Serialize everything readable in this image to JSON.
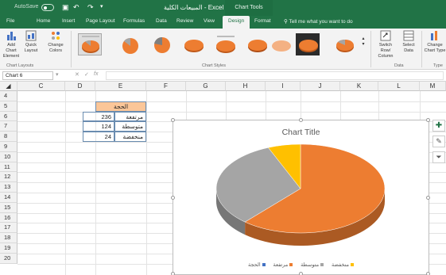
{
  "app": {
    "autosave_label": "AutoSave",
    "doc_title": "المبيعات الكلية - Excel",
    "context_tab": "Chart Tools"
  },
  "tabs": [
    "File",
    "Home",
    "Insert",
    "Page Layout",
    "Formulas",
    "Data",
    "Review",
    "View",
    "Design",
    "Format"
  ],
  "tell_me": "Tell me what you want to do",
  "ribbon": {
    "add_chart_element": "Add Chart Element",
    "quick_layout": "Quick Layout",
    "change_colors": "Change Colors",
    "group_layouts": "Chart Layouts",
    "group_styles": "Chart Styles",
    "switch_row_col": "Switch Row/ Column",
    "select_data": "Select Data",
    "group_data": "Data",
    "change_chart_type": "Change Chart Type",
    "group_type": "Type"
  },
  "formula_bar": {
    "name_box": "Chart 6",
    "fx": "fx",
    "value": ""
  },
  "columns": [
    "C",
    "D",
    "E",
    "F",
    "G",
    "H",
    "I",
    "J",
    "K",
    "L",
    "M"
  ],
  "rows": [
    "4",
    "5",
    "6",
    "7",
    "8",
    "9",
    "10",
    "11",
    "12",
    "13",
    "14",
    "15",
    "16",
    "17",
    "18",
    "19",
    "20"
  ],
  "table": {
    "header": "الحجة",
    "rows": [
      {
        "value": "236",
        "label": "مرتفعة"
      },
      {
        "value": "124",
        "label": "متوسطة"
      },
      {
        "value": "24",
        "label": "منخفضة"
      }
    ]
  },
  "chart": {
    "title": "Chart Title",
    "legend": [
      "منخفضة",
      "متوسطة",
      "مرتفعة",
      "الحجة"
    ]
  },
  "chart_data": {
    "type": "pie",
    "title": "Chart Title",
    "categories": [
      "مرتفعة",
      "متوسطة",
      "منخفضة"
    ],
    "values": [
      236,
      124,
      24
    ],
    "colors": [
      "#ed7d31",
      "#a5a5a5",
      "#ffc000"
    ]
  },
  "colors": {
    "excel_green": "#217346",
    "table_header": "#fbc698"
  }
}
